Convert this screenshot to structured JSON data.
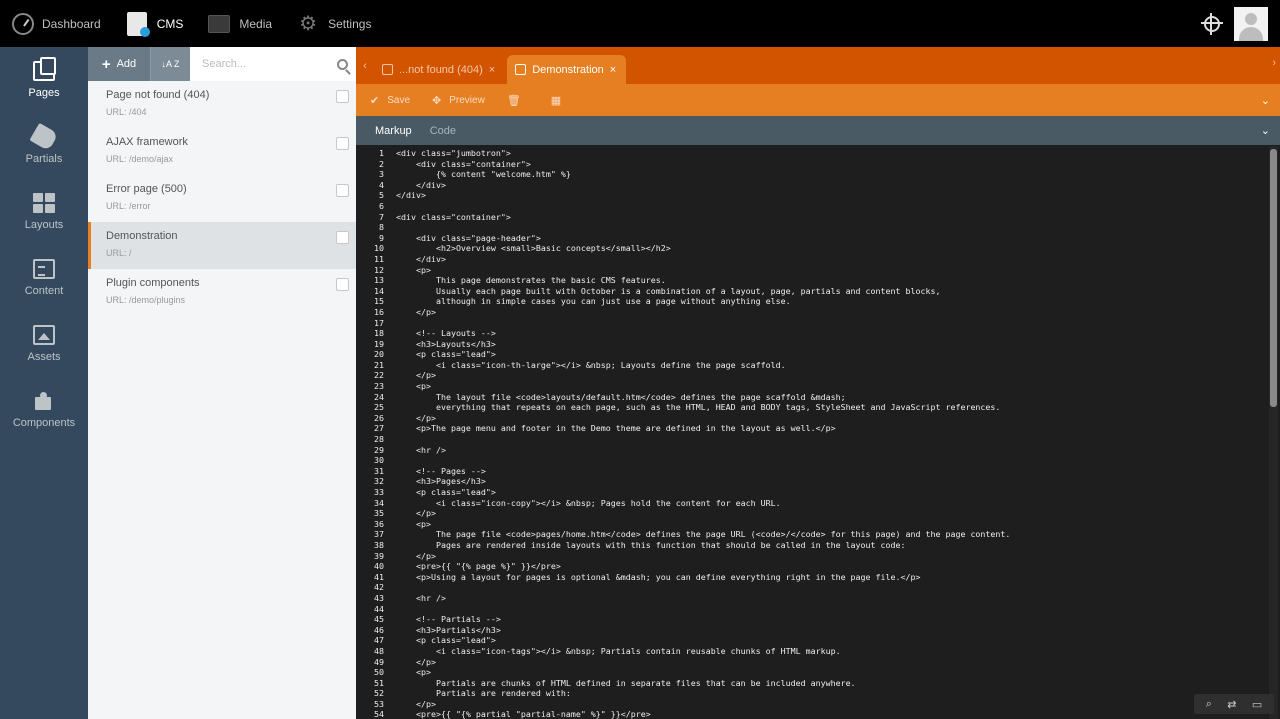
{
  "topnav": {
    "items": [
      {
        "label": "Dashboard"
      },
      {
        "label": "CMS"
      },
      {
        "label": "Media"
      },
      {
        "label": "Settings"
      }
    ]
  },
  "sidebar": {
    "items": [
      {
        "label": "Pages"
      },
      {
        "label": "Partials"
      },
      {
        "label": "Layouts"
      },
      {
        "label": "Content"
      },
      {
        "label": "Assets"
      },
      {
        "label": "Components"
      }
    ]
  },
  "listpanel": {
    "add_label": "Add",
    "sort_label": "↓A Z",
    "search_placeholder": "Search...",
    "pages": [
      {
        "title": "Page not found (404)",
        "url": "URL: /404"
      },
      {
        "title": "AJAX framework",
        "url": "URL: /demo/ajax"
      },
      {
        "title": "Error page (500)",
        "url": "URL: /error"
      },
      {
        "title": "Demonstration",
        "url": "URL: /"
      },
      {
        "title": "Plugin components",
        "url": "URL: /demo/plugins"
      }
    ]
  },
  "editor": {
    "tabs": [
      {
        "label": "...not found (404)"
      },
      {
        "label": "Demonstration"
      }
    ],
    "toolbar": {
      "save_label": "Save",
      "preview_label": "Preview"
    },
    "subtabs": [
      {
        "label": "Markup"
      },
      {
        "label": "Code"
      }
    ],
    "code_lines": [
      "<div class=\"jumbotron\">",
      "    <div class=\"container\">",
      "        {% content \"welcome.htm\" %}",
      "    </div>",
      "</div>",
      "",
      "<div class=\"container\">",
      "",
      "    <div class=\"page-header\">",
      "        <h2>Overview <small>Basic concepts</small></h2>",
      "    </div>",
      "    <p>",
      "        This page demonstrates the basic CMS features.",
      "        Usually each page built with October is a combination of a layout, page, partials and content blocks,",
      "        although in simple cases you can just use a page without anything else.",
      "    </p>",
      "",
      "    <!-- Layouts -->",
      "    <h3>Layouts</h3>",
      "    <p class=\"lead\">",
      "        <i class=\"icon-th-large\"></i> &nbsp; Layouts define the page scaffold.",
      "    </p>",
      "    <p>",
      "        The layout file <code>layouts/default.htm</code> defines the page scaffold &mdash;",
      "        everything that repeats on each page, such as the HTML, HEAD and BODY tags, StyleSheet and JavaScript references.",
      "    </p>",
      "    <p>The page menu and footer in the Demo theme are defined in the layout as well.</p>",
      "",
      "    <hr />",
      "",
      "    <!-- Pages -->",
      "    <h3>Pages</h3>",
      "    <p class=\"lead\">",
      "        <i class=\"icon-copy\"></i> &nbsp; Pages hold the content for each URL.",
      "    </p>",
      "    <p>",
      "        The page file <code>pages/home.htm</code> defines the page URL (<code>/</code> for this page) and the page content.",
      "        Pages are rendered inside layouts with this function that should be called in the layout code:",
      "    </p>",
      "    <pre>{{ \"{% page %}\" }}</pre>",
      "    <p>Using a layout for pages is optional &mdash; you can define everything right in the page file.</p>",
      "",
      "    <hr />",
      "",
      "    <!-- Partials -->",
      "    <h3>Partials</h3>",
      "    <p class=\"lead\">",
      "        <i class=\"icon-tags\"></i> &nbsp; Partials contain reusable chunks of HTML markup.",
      "    </p>",
      "    <p>",
      "        Partials are chunks of HTML defined in separate files that can be included anywhere.",
      "        Partials are rendered with:",
      "    </p>",
      "    <pre>{{ \"{% partial \"partial-name\" %}\" }}</pre>"
    ]
  },
  "colors": {
    "topnav_bg": "#000000",
    "sidebar_bg": "#34495e",
    "tabbar_bg": "#d35400",
    "toolbar_bg": "#e67e22",
    "editor_bg": "#1e1e1e"
  }
}
